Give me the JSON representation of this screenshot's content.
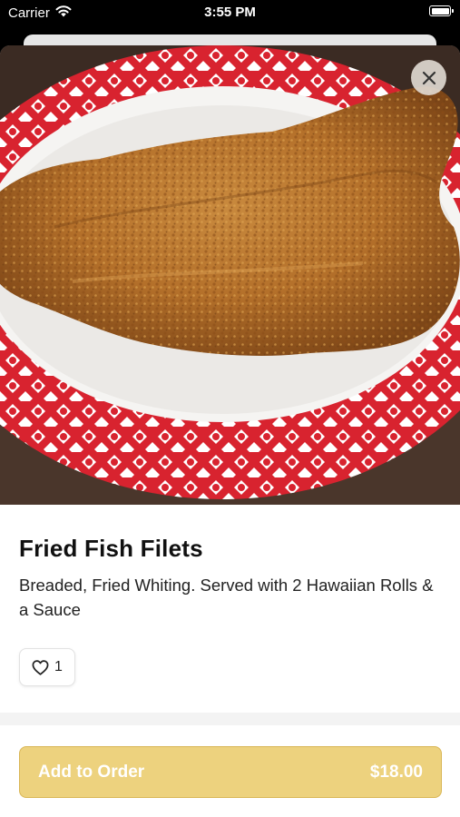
{
  "status_bar": {
    "carrier": "Carrier",
    "time": "3:55 PM",
    "wifi_icon": "wifi-icon",
    "battery_icon": "battery-icon"
  },
  "hero": {
    "image": "fried-fish-photo",
    "close_icon": "close-icon"
  },
  "item": {
    "title": "Fried Fish Filets",
    "description": "Breaded, Fried Whiting. Served with 2 Hawaiian Rolls & a Sauce",
    "like_icon": "heart-icon",
    "like_count": "1"
  },
  "order": {
    "label": "Add to Order",
    "price": "$18.00",
    "button_color": "#edd27e"
  }
}
